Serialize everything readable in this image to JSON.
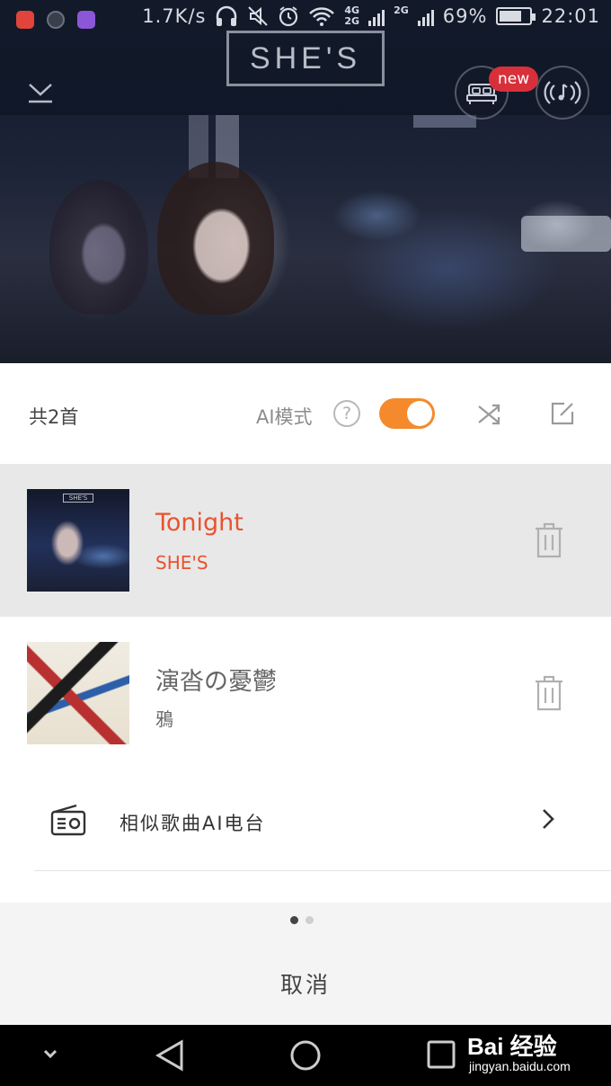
{
  "status_bar": {
    "speed": "1.7K/s",
    "network1": "4G",
    "network2": "2G",
    "network3": "2G",
    "battery": "69%",
    "time": "22:01"
  },
  "header": {
    "logo": "SHE'S",
    "new_badge": "new"
  },
  "playlist": {
    "count_label": "共2首",
    "ai_mode_label": "AI模式",
    "help_symbol": "?",
    "ai_mode_on": true,
    "songs": [
      {
        "title": "Tonight",
        "artist": "SHE'S",
        "active": true,
        "cover_logo": "SHE'S"
      },
      {
        "title": "演沓の憂鬱",
        "artist": "鴉",
        "active": false
      }
    ],
    "radio_label": "相似歌曲AI电台"
  },
  "footer": {
    "cancel_label": "取消",
    "page_dots": 2,
    "current_dot": 1
  },
  "watermark": {
    "brand": "Bai 经验",
    "url": "jingyan.baidu.com"
  },
  "colors": {
    "accent": "#e8532e",
    "toggle": "#f48a2c",
    "badge": "#d8303a"
  }
}
